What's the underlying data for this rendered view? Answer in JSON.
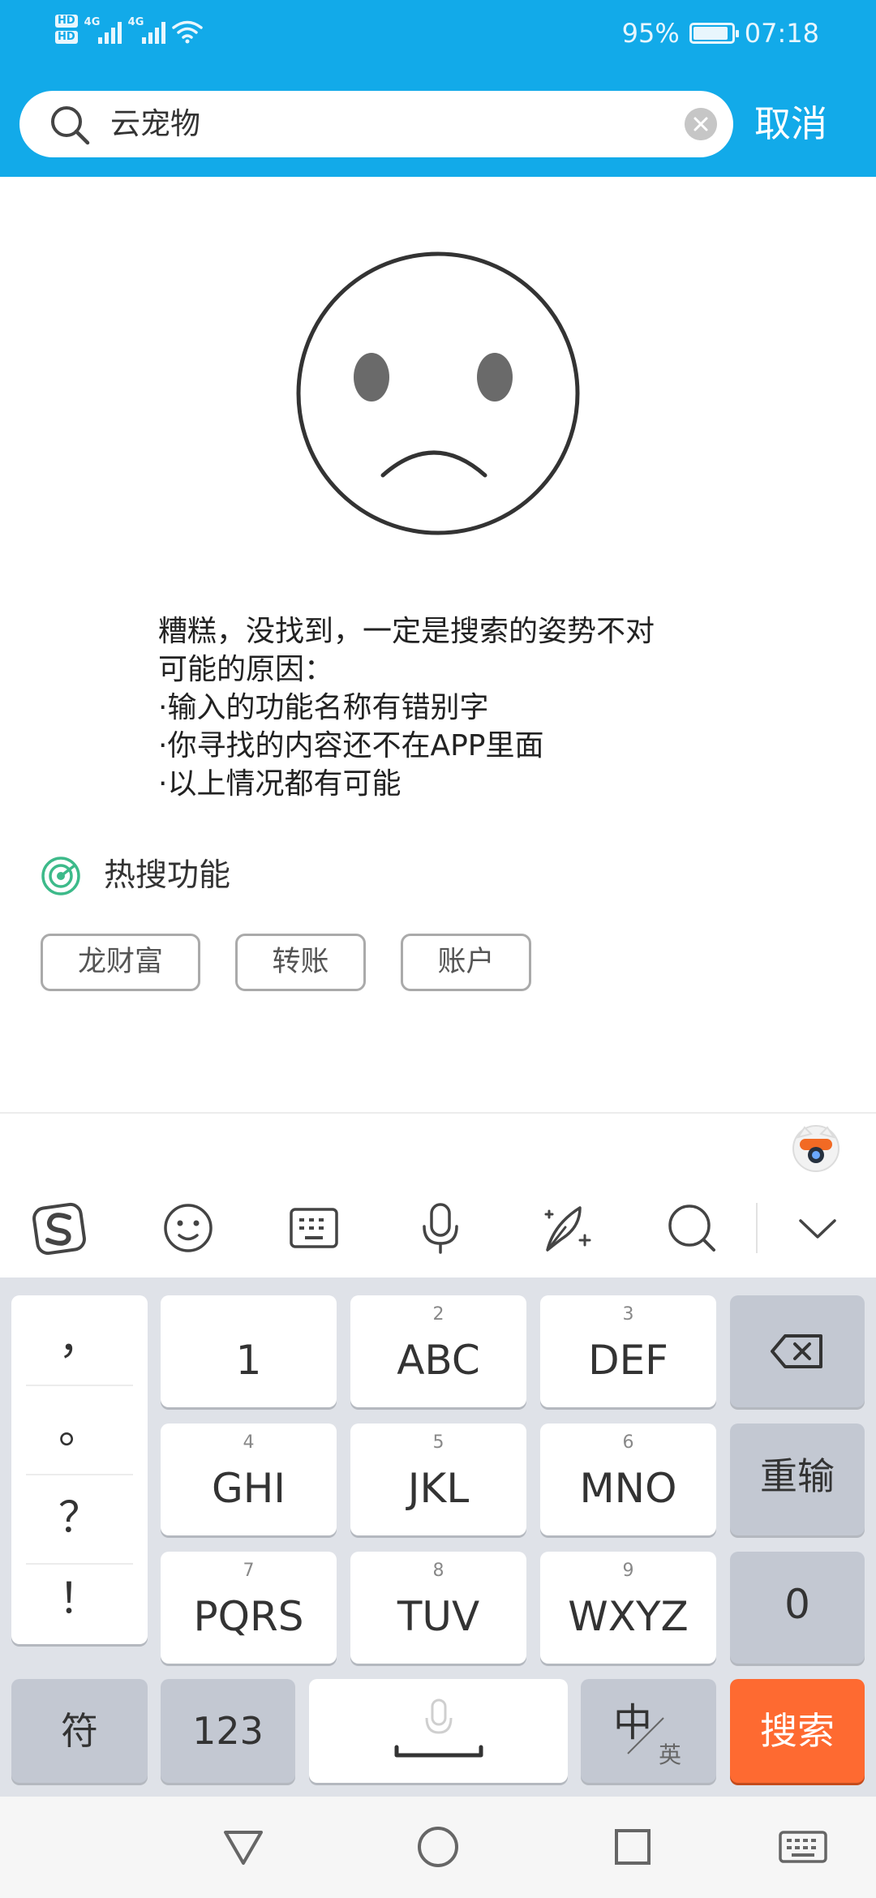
{
  "status_bar": {
    "hd1": "HD",
    "hd2": "HD",
    "network1": "4G",
    "network2": "4G",
    "battery": "95%",
    "time": "07:18"
  },
  "search": {
    "query": "云宠物",
    "cancel_label": "取消"
  },
  "empty_result": {
    "lines": [
      "糟糕，没找到，一定是搜索的姿势不对",
      "可能的原因：",
      "·输入的功能名称有错别字",
      "·你寻找的内容还不在APP里面",
      "·以上情况都有可能"
    ]
  },
  "hot_search": {
    "title": "热搜功能",
    "tags": [
      "龙财富",
      "转账",
      "账户"
    ]
  },
  "keyboard": {
    "punctuation": [
      "，",
      "。",
      "？",
      "！"
    ],
    "keys": [
      {
        "sub": "",
        "main": "1"
      },
      {
        "sub": "2",
        "main": "ABC"
      },
      {
        "sub": "3",
        "main": "DEF"
      },
      {
        "sub": "4",
        "main": "GHI"
      },
      {
        "sub": "5",
        "main": "JKL"
      },
      {
        "sub": "6",
        "main": "MNO"
      },
      {
        "sub": "7",
        "main": "PQRS"
      },
      {
        "sub": "8",
        "main": "TUV"
      },
      {
        "sub": "9",
        "main": "WXYZ"
      }
    ],
    "reenter_label": "重输",
    "zero_label": "0",
    "symbol_label": "符",
    "num_label": "123",
    "lang_main": "中",
    "lang_sub": "英",
    "search_label": "搜索"
  },
  "colors": {
    "header": "#12aae9",
    "accent": "#fe6a31",
    "hot_icon": "#3dba8a"
  }
}
